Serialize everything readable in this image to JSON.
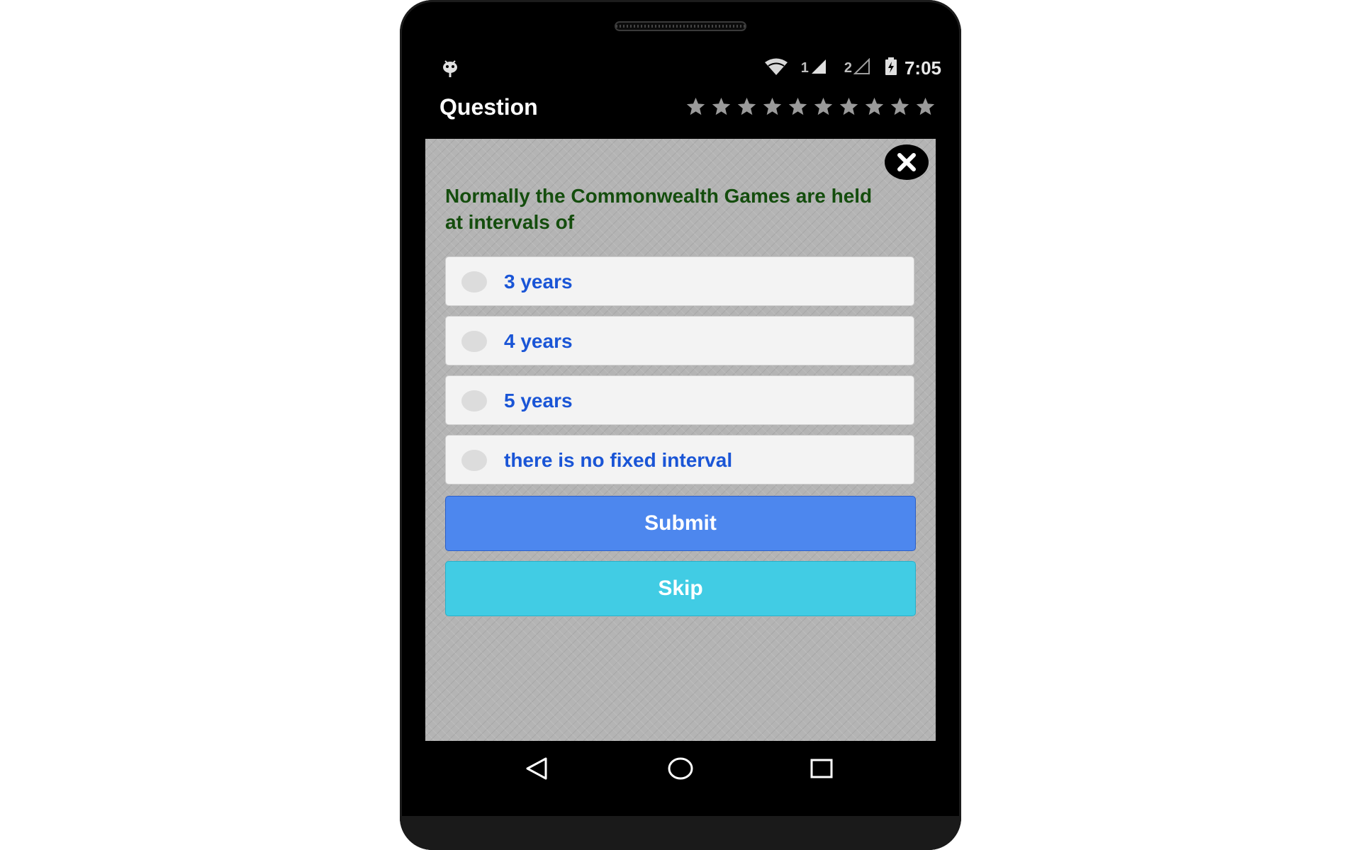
{
  "status_bar": {
    "sim1_label": "1",
    "sim2_label": "2",
    "time": "7:05",
    "icons": [
      "android-debug-icon",
      "wifi-icon",
      "signal-sim1-icon",
      "signal-sim2-icon",
      "battery-charging-icon"
    ]
  },
  "header": {
    "title": "Question",
    "star_count": 10,
    "stars_filled": 0
  },
  "quiz": {
    "question": "Normally the Commonwealth Games are held at intervals of",
    "options": [
      {
        "label": "3 years",
        "selected": false
      },
      {
        "label": "4 years",
        "selected": false
      },
      {
        "label": "5 years",
        "selected": false
      },
      {
        "label": "there is no fixed interval",
        "selected": false
      }
    ],
    "submit_label": "Submit",
    "skip_label": "Skip"
  },
  "navigation": {
    "icons": [
      "back-icon",
      "home-icon",
      "recents-icon"
    ]
  },
  "colors": {
    "question_text": "#144d0d",
    "option_text": "#1a55d6",
    "submit_bg": "#4d87ee",
    "skip_bg": "#41cce4",
    "screen_bg": "#b4b4b4"
  }
}
